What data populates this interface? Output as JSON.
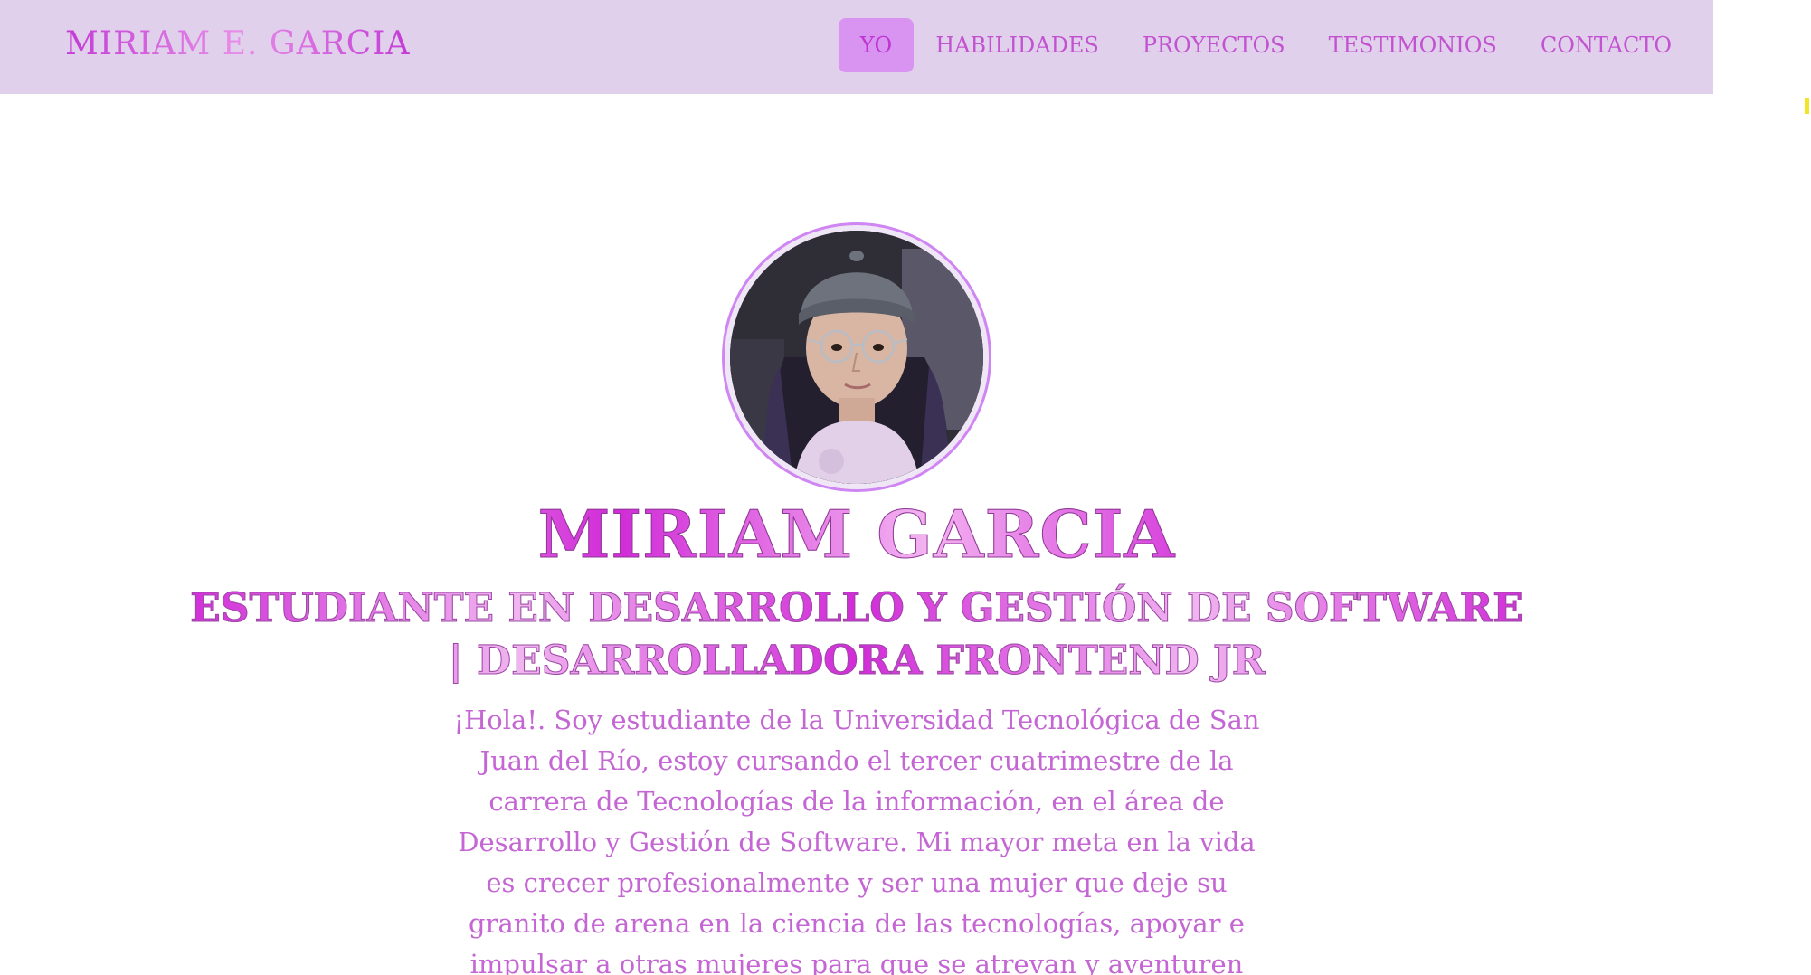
{
  "header": {
    "brand": "MIRIAM E. GARCIA",
    "nav": [
      {
        "label": "YO",
        "active": true
      },
      {
        "label": "HABILIDADES",
        "active": false
      },
      {
        "label": "PROYECTOS",
        "active": false
      },
      {
        "label": "TESTIMONIOS",
        "active": false
      },
      {
        "label": "CONTACTO",
        "active": false
      }
    ]
  },
  "hero": {
    "name": "MIRIAM GARCIA",
    "role": "ESTUDIANTE EN DESARROLLO Y GESTIÓN DE SOFTWARE | DESARROLLADORA FRONTEND JR",
    "bio": "¡Hola!. Soy estudiante de la Universidad Tecnológica de San Juan del Río, estoy cursando el tercer cuatrimestre de la carrera de Tecnologías de la información, en el área de Desarrollo y Gestión de Software. Mi mayor meta en la vida es crecer profesionalmente y ser una mujer que deje su granito de arena en la ciencia de las tecnologías, apoyar e impulsar a otras mujeres para que se atrevan y aventuren"
  },
  "colors": {
    "nav_bg": "#e1d0ec",
    "nav_active_bg": "#d994f2",
    "accent": "#d12bd8",
    "text_pink": "#c466d3"
  }
}
